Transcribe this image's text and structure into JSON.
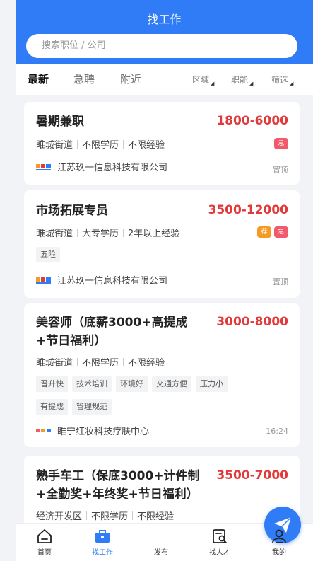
{
  "header": {
    "title": "找工作"
  },
  "search": {
    "placeholder": "搜索职位 / 公司"
  },
  "tabs": [
    {
      "label": "最新",
      "active": true
    },
    {
      "label": "急聘",
      "active": false
    },
    {
      "label": "附近",
      "active": false
    }
  ],
  "filters": [
    "区域",
    "职能",
    "筛选"
  ],
  "jobs": [
    {
      "title": "暑期兼职",
      "salary": "1800-6000",
      "location": "睢城街道",
      "education": "不限学历",
      "experience": "不限经验",
      "badges": [
        "急"
      ],
      "tags": [],
      "company": "江苏玖一信息科技有限公司",
      "note": "置顶"
    },
    {
      "title": "市场拓展专员",
      "salary": "3500-12000",
      "location": "睢城街道",
      "education": "大专学历",
      "experience": "2年以上经验",
      "badges": [
        "荐",
        "急"
      ],
      "tags": [
        "五险"
      ],
      "company": "江苏玖一信息科技有限公司",
      "note": "置顶"
    },
    {
      "title_line1": "美容师（底薪3000+高提成",
      "title_line2": "+节日福利）",
      "salary": "3000-8000",
      "location": "睢城街道",
      "education": "不限学历",
      "experience": "不限经验",
      "tags_row1": [
        "晋升快",
        "技术培训",
        "环境好",
        "交通方便",
        "压力小"
      ],
      "tags_row2": [
        "有提成",
        "管理规范"
      ],
      "company": "睢宁红妆科技疗肤中心",
      "note": "16:24"
    },
    {
      "title_line1": "熟手车工（保底3000+计件制",
      "title_line2": "+全勤奖+年终奖+节日福利）",
      "salary": "3500-7000",
      "location": "经济开发区",
      "education": "不限学历",
      "experience": "不限经验"
    }
  ],
  "bottom_nav": [
    {
      "label": "首页",
      "icon": "home-icon"
    },
    {
      "label": "找工作",
      "icon": "briefcase-icon",
      "active": true
    },
    {
      "label": "发布",
      "icon": "paper-plane-icon"
    },
    {
      "label": "找人才",
      "icon": "find-talent-icon"
    },
    {
      "label": "我的",
      "icon": "user-icon"
    }
  ],
  "colors": {
    "primary": "#2f7cf6",
    "salary": "#e23a3a",
    "urgent": "#f25a6b",
    "recommend": "#f59a23"
  }
}
